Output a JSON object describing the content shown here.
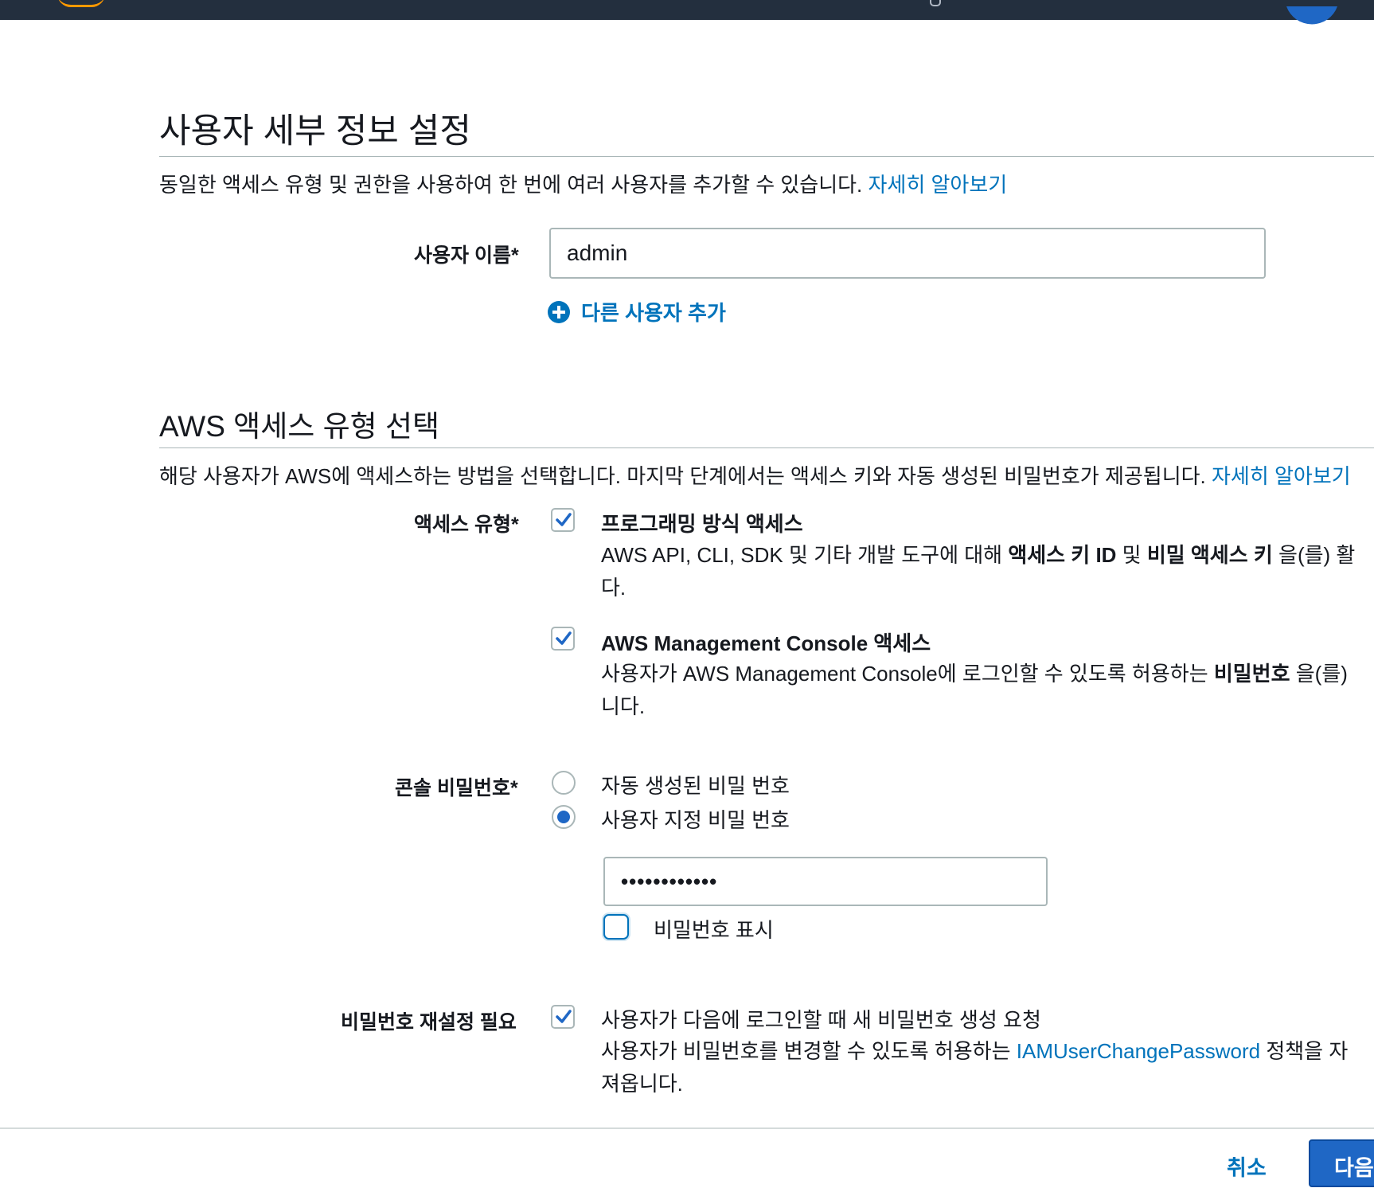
{
  "header": {
    "page_title": "사용자 세부 정보 설정",
    "description": "동일한 액세스 유형 및 권한을 사용하여 한 번에 여러 사용자를 추가할 수 있습니다.",
    "learn_more": "자세히 알아보기"
  },
  "user": {
    "name_label": "사용자 이름*",
    "name_value": "admin",
    "add_user_label": "다른 사용자 추가"
  },
  "access_section": {
    "title": "AWS 액세스 유형 선택",
    "description": "해당 사용자가 AWS에 액세스하는 방법을 선택합니다. 마지막 단계에서는 액세스 키와 자동 생성된 비밀번호가 제공됩니다.",
    "learn_more": "자세히 알아보기",
    "access_type_label": "액세스 유형*",
    "programmatic": {
      "checked": true,
      "title": "프로그래밍 방식 액세스",
      "desc_prefix": "AWS API, CLI, SDK 및 기타 개발 도구에 대해 ",
      "desc_bold1": "액세스 키 ID",
      "desc_mid": " 및 ",
      "desc_bold2": "비밀 액세스 키",
      "desc_suffix": " 을(를) 활",
      "desc_line2": "다."
    },
    "console": {
      "checked": true,
      "title": "AWS Management Console 액세스",
      "desc_prefix": "사용자가 AWS Management Console에 로그인할 수 있도록 허용하는 ",
      "desc_bold": "비밀번호",
      "desc_suffix": " 을(를)",
      "desc_line2": "니다."
    }
  },
  "password": {
    "label": "콘솔 비밀번호*",
    "auto_label": "자동 생성된 비밀 번호",
    "custom_label": "사용자 지정 비밀 번호",
    "selected": "custom",
    "masked_value": "••••••••••••",
    "show_label": "비밀번호 표시",
    "show_checked": false
  },
  "reset": {
    "label": "비밀번호 재설정 필요",
    "checked": true,
    "text": "사용자가 다음에 로그인할 때 새 비밀번호 생성 요청",
    "desc_prefix": "사용자가 비밀번호를 변경할 수 있도록 허용하는 ",
    "desc_link": "IAMUserChangePassword",
    "desc_suffix": " 정책을 자",
    "desc_line2": "져옵니다."
  },
  "footer": {
    "cancel": "취소",
    "next": "다음: 권한"
  },
  "colors": {
    "link": "#0073bb",
    "primary": "#1f67c5",
    "topbar": "#232f3e"
  }
}
